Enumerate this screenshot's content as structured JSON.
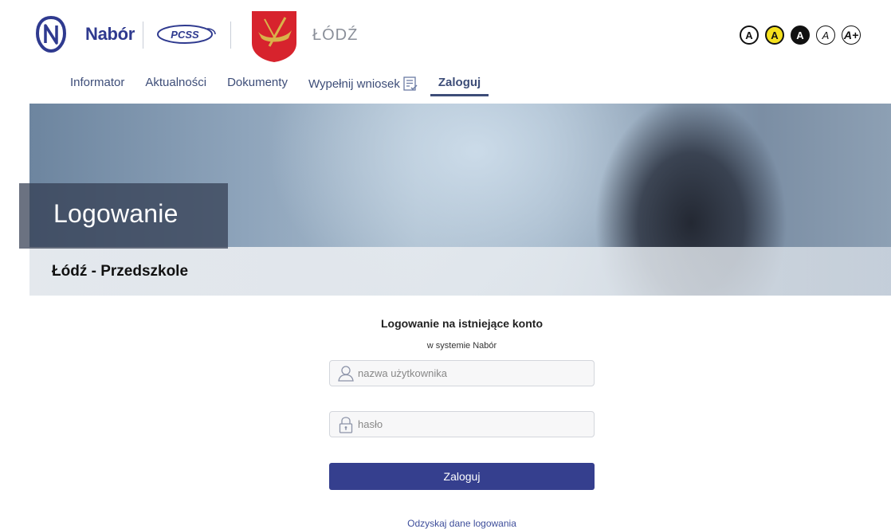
{
  "header": {
    "brand_name": "Nabór",
    "city_name": "ŁÓDŹ",
    "pcss_label": "PCSS"
  },
  "accessibility": [
    "A",
    "A",
    "A",
    "A",
    "A+"
  ],
  "nav": {
    "items": [
      {
        "label": "Informator"
      },
      {
        "label": "Aktualności"
      },
      {
        "label": "Dokumenty"
      },
      {
        "label": "Wypełnij wniosek"
      },
      {
        "label": "Zaloguj",
        "active": true
      }
    ]
  },
  "hero": {
    "title": "Logowanie",
    "subtitle": "Łódź - Przedszkole"
  },
  "login": {
    "title": "Logowanie na istniejące konto",
    "subtitle": "w systemie Nabór",
    "username_placeholder": "nazwa użytkownika",
    "password_placeholder": "hasło",
    "submit_label": "Zaloguj",
    "recover_label": "Odzyskaj dane logowania"
  },
  "colors": {
    "brand": "#2f3a8f",
    "button": "#353f8e",
    "nav_text": "#3d4d78",
    "coat_red": "#d7232d",
    "coat_gold": "#d9b24a"
  }
}
